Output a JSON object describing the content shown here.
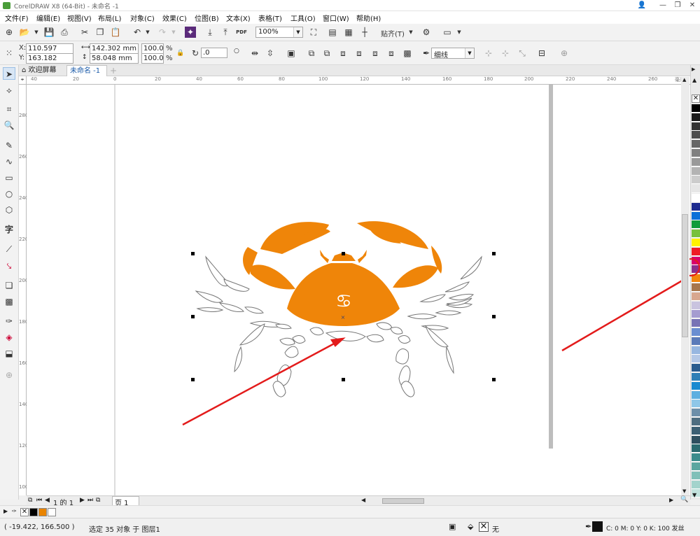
{
  "window": {
    "title": "CorelDRAW X8 (64-Bit) - 未命名 -1",
    "btn_user": "👤",
    "btn_min": "—",
    "btn_max": "❐",
    "btn_close": "✕"
  },
  "menu": [
    "文件(F)",
    "编辑(E)",
    "视图(V)",
    "布局(L)",
    "对象(C)",
    "效果(C)",
    "位图(B)",
    "文本(X)",
    "表格(T)",
    "工具(O)",
    "窗口(W)",
    "帮助(H)"
  ],
  "standard_toolbar": {
    "zoom_value": "100%",
    "snap_label": "贴齐(T)",
    "pdf_label": "PDF"
  },
  "property_bar": {
    "x_label": "X:",
    "x_value": "110.597 mm",
    "y_label": "Y:",
    "y_value": "163.182 mm",
    "w_value": "142.302 mm",
    "h_value": "58.048 mm",
    "scale_x": "100.0",
    "scale_y": "100.0",
    "percent": "%",
    "rotation": ".0",
    "outline_width": "细线"
  },
  "tabs": [
    {
      "label": "欢迎屏幕"
    },
    {
      "label": "未命名 -1"
    }
  ],
  "ruler": {
    "h_labels": [
      "40",
      "20",
      "0",
      "20",
      "40",
      "60",
      "80",
      "100",
      "120",
      "140",
      "160",
      "180",
      "200",
      "220",
      "240",
      "260"
    ],
    "h_unit": "毫米",
    "v_labels": [
      "280",
      "260",
      "240",
      "220",
      "200",
      "180",
      "160",
      "140",
      "120",
      "100"
    ]
  },
  "pagebar": {
    "page_of": "1 的 1",
    "page_tab": "页 1"
  },
  "palette_colors": [
    "#000000",
    "#1a1a1a",
    "#333333",
    "#4d4d4d",
    "#666666",
    "#808080",
    "#999999",
    "#b3b3b3",
    "#cccccc",
    "#e6e6e6",
    "#ffffff",
    "#1e2b8f",
    "#0a6fd8",
    "#0f9c3a",
    "#78c13b",
    "#fff200",
    "#ee1c25",
    "#d6006f",
    "#8c2d8c",
    "#f2860d",
    "#a7764c",
    "#d8a78f",
    "#c9c3df",
    "#a59cd0",
    "#7873b5",
    "#6a8ed1",
    "#5b7bb9",
    "#97b7e0",
    "#b4c8e6",
    "#2a5c8e",
    "#2e7fb6",
    "#1a8ad0",
    "#5dafe0",
    "#8fc7e8",
    "#6d8fa9",
    "#4e6d80",
    "#3c5f73",
    "#2f4f5f",
    "#2b6a6f",
    "#3c8c8c",
    "#5aa6a0",
    "#80c0b8",
    "#a3d3cc",
    "#c2e2dd"
  ],
  "doc_palette": [
    "#000000",
    "#e98400",
    "#ffffff"
  ],
  "status": {
    "coords": "( -19.422, 166.500 )",
    "selection": "选定 35 对象 于 图层1",
    "fill_label": "无",
    "outline_text": "C: 0 M: 0 Y: 0 K: 100  发丝"
  },
  "colors": {
    "crab_orange": "#ef8509",
    "arrow_red": "#e31b1b",
    "selected_swatch": "#f2860d"
  }
}
